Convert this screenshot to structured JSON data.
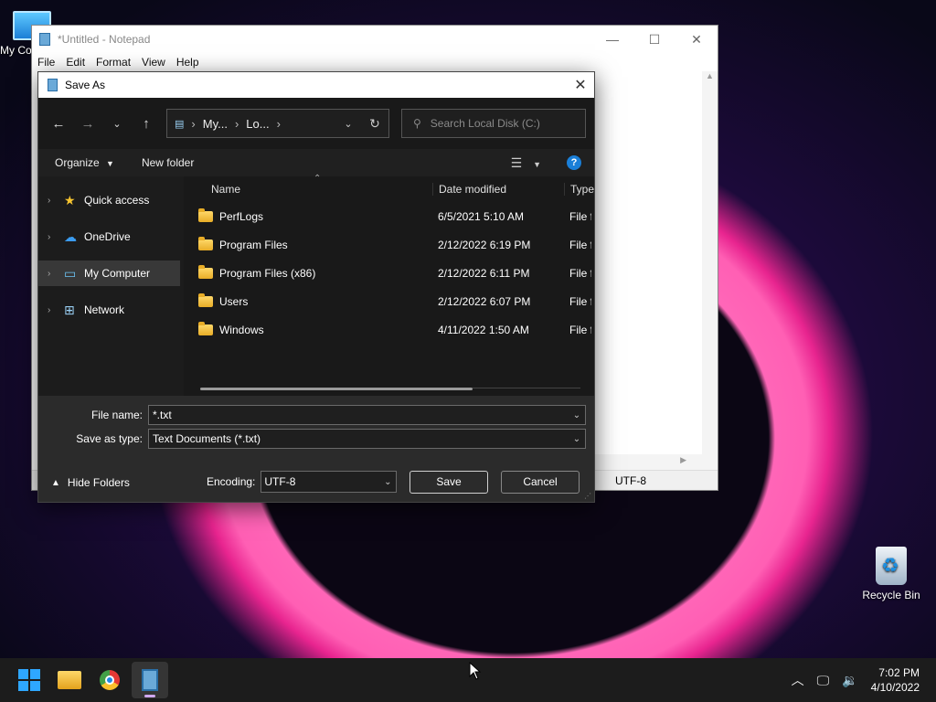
{
  "desktop": {
    "my_computer_label": "My Co",
    "recycle_bin_label": "Recycle Bin"
  },
  "notepad": {
    "title": "*Untitled - Notepad",
    "menu": [
      "File",
      "Edit",
      "Format",
      "View",
      "Help"
    ],
    "encoding": "UTF-8"
  },
  "dialog": {
    "title": "Save As",
    "breadcrumb": [
      "My...",
      "Lo..."
    ],
    "search_placeholder": "Search Local Disk (C:)",
    "organize_label": "Organize",
    "new_folder_label": "New folder",
    "nav_items": [
      {
        "label": "Quick access"
      },
      {
        "label": "OneDrive"
      },
      {
        "label": "My Computer"
      },
      {
        "label": "Network"
      }
    ],
    "columns": {
      "name": "Name",
      "date": "Date modified",
      "type": "Type"
    },
    "files": [
      {
        "name": "PerfLogs",
        "date": "6/5/2021 5:10 AM",
        "type": "File folder"
      },
      {
        "name": "Program Files",
        "date": "2/12/2022 6:19 PM",
        "type": "File folder"
      },
      {
        "name": "Program Files (x86)",
        "date": "2/12/2022 6:11 PM",
        "type": "File folder"
      },
      {
        "name": "Users",
        "date": "2/12/2022 6:07 PM",
        "type": "File folder"
      },
      {
        "name": "Windows",
        "date": "4/11/2022 1:50 AM",
        "type": "File folder"
      }
    ],
    "file_name_label": "File name:",
    "file_name_value": "*.txt",
    "save_type_label": "Save as type:",
    "save_type_value": "Text Documents (*.txt)",
    "hide_folders_label": "Hide Folders",
    "encoding_label": "Encoding:",
    "encoding_value": "UTF-8",
    "save_label": "Save",
    "cancel_label": "Cancel"
  },
  "taskbar": {
    "time": "7:02 PM",
    "date": "4/10/2022"
  }
}
